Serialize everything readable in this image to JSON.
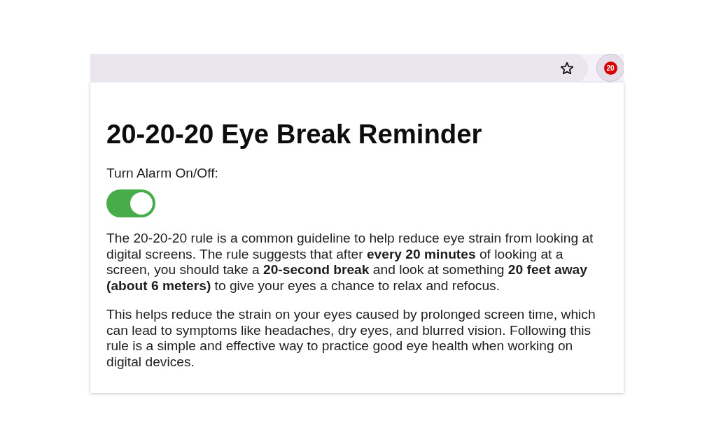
{
  "browser_toolbar": {
    "extension_badge": "20"
  },
  "popup": {
    "title": "20-20-20 Eye Break Reminder",
    "alarm": {
      "label": "Turn Alarm On/Off:",
      "on": true
    },
    "paragraphs": [
      "The 20-20-20 rule is a common guideline to help reduce eye strain from looking at digital screens. The rule suggests that after **every 20 minutes** of looking at a screen, you should take a **20-second break** and look at something **20 feet away (about 6 meters)** to give your eyes a chance to relax and refocus.",
      "This helps reduce the strain on your eyes caused by prolonged screen time, which can lead to symptoms like headaches, dry eyes, and blurred vision. Following this rule is a simple and effective way to practice good eye health when working on digital devices."
    ]
  }
}
